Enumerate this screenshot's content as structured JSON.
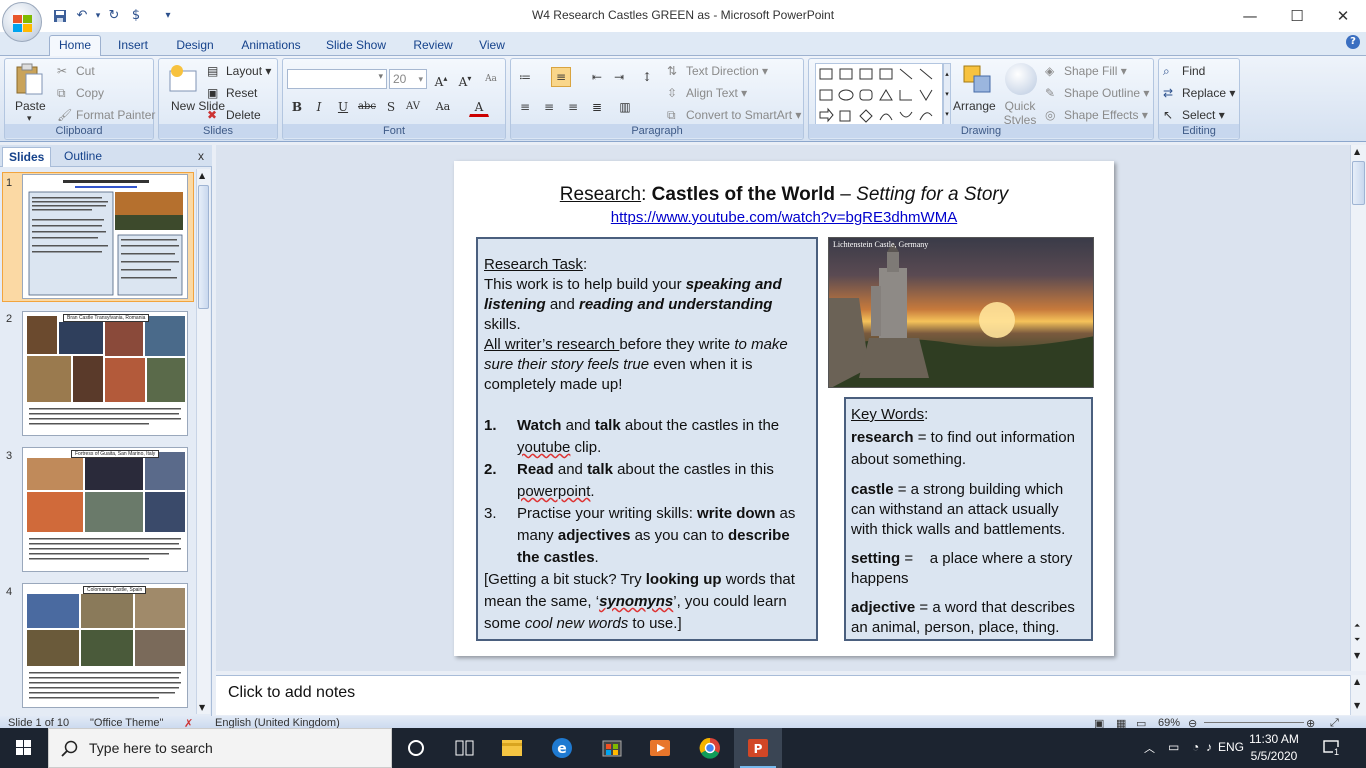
{
  "window": {
    "title": "W4 Research Castles GREEN as - Microsoft PowerPoint",
    "minimize": "—",
    "maximize": "☐",
    "close": "✕"
  },
  "tabs": [
    "Home",
    "Insert",
    "Design",
    "Animations",
    "Slide Show",
    "Review",
    "View"
  ],
  "active_tab": "Home",
  "ribbon": {
    "clipboard": {
      "label": "Clipboard",
      "paste": "Paste",
      "cut": "Cut",
      "copy": "Copy",
      "format_painter": "Format Painter"
    },
    "slides": {
      "label": "Slides",
      "new_slide": "New Slide",
      "layout": "Layout",
      "reset": "Reset",
      "delete": "Delete"
    },
    "font": {
      "label": "Font",
      "font_name": "",
      "font_size": "20"
    },
    "paragraph": {
      "label": "Paragraph",
      "text_direction": "Text Direction",
      "align_text": "Align Text",
      "convert_smartart": "Convert to SmartArt"
    },
    "drawing": {
      "label": "Drawing",
      "arrange": "Arrange",
      "quick_styles": "Quick Styles",
      "shape_fill": "Shape Fill",
      "shape_outline": "Shape Outline",
      "shape_effects": "Shape Effects"
    },
    "editing": {
      "label": "Editing",
      "find": "Find",
      "replace": "Replace",
      "select": "Select"
    }
  },
  "panel": {
    "tab_slides": "Slides",
    "tab_outline": "Outline",
    "close": "x",
    "thumbnails": [
      {
        "num": "1",
        "caption": ""
      },
      {
        "num": "2",
        "caption": "Bran Castle Transylvania,  Romania"
      },
      {
        "num": "3",
        "caption": "Fortress of Guaita, San Marino, Italy"
      },
      {
        "num": "4",
        "caption": "Colomares Castle, Spain"
      }
    ]
  },
  "slide": {
    "title_research": "Research",
    "title_colon": ":  ",
    "title_main": "Castles of the World",
    "title_dash": " – ",
    "title_italic": "Setting for a Story",
    "link": "https://www.youtube.com/watch?v=bgRE3dhmWMA",
    "task_heading": "Research Task",
    "task_colon": ":",
    "task_p1_a": "This work is to help build your ",
    "task_p1_b": "speaking and listening",
    "task_p1_c": " and ",
    "task_p1_d": "reading and understanding",
    "task_p1_e": " skills.",
    "task_p2_a": "All writer’s research ",
    "task_p2_b": "before they write ",
    "task_p2_c": "to make sure their story feels true",
    "task_p2_d": " even when it is completely made up!",
    "list": [
      {
        "n": "1.",
        "a": "Watch",
        "b": " and ",
        "c": "talk",
        "d": " about the castles in the ",
        "e": "youtube",
        "f": " clip."
      },
      {
        "n": "2.",
        "a": "Read",
        "b": " and ",
        "c": "talk",
        "d": " about the castles in this ",
        "e": "powerpoint",
        "f": "."
      },
      {
        "n": "3.",
        "a": "Practise your writing skills: ",
        "b": "write down",
        "c": " as many ",
        "d": "adjectives",
        "e": " as you can to ",
        "f": "describe the castles",
        "g": "."
      }
    ],
    "stuck_a": "[Getting a bit stuck? Try ",
    "stuck_b": "looking up",
    "stuck_c": " words that mean the same, ‘",
    "stuck_d": "synomyns",
    "stuck_e": "’, you could learn some ",
    "stuck_f": "cool new words",
    "stuck_g": " to use.]",
    "image_caption": "Lichtenstein Castle, Germany",
    "keywords_heading": "Key Words",
    "keywords_colon": ":",
    "keywords": [
      {
        "term": "research",
        "def": " = to find out information about something."
      },
      {
        "term": "castle",
        "def": " = a strong building which can withstand an attack usually with thick walls and battlements."
      },
      {
        "term": "setting",
        "def": " =    a place where a story happens"
      },
      {
        "term": "adjective",
        "def": " = a word that describes an animal, person, place, thing."
      }
    ]
  },
  "notes": {
    "placeholder": "Click to add notes"
  },
  "status": {
    "slide": "Slide 1 of 10",
    "theme": "\"Office Theme\"",
    "language": "English (United Kingdom)",
    "zoom": "69%"
  },
  "taskbar": {
    "search_placeholder": "Type here to search",
    "language": "ENG",
    "time": "11:30 AM",
    "date": "5/5/2020",
    "notifications": "1"
  }
}
